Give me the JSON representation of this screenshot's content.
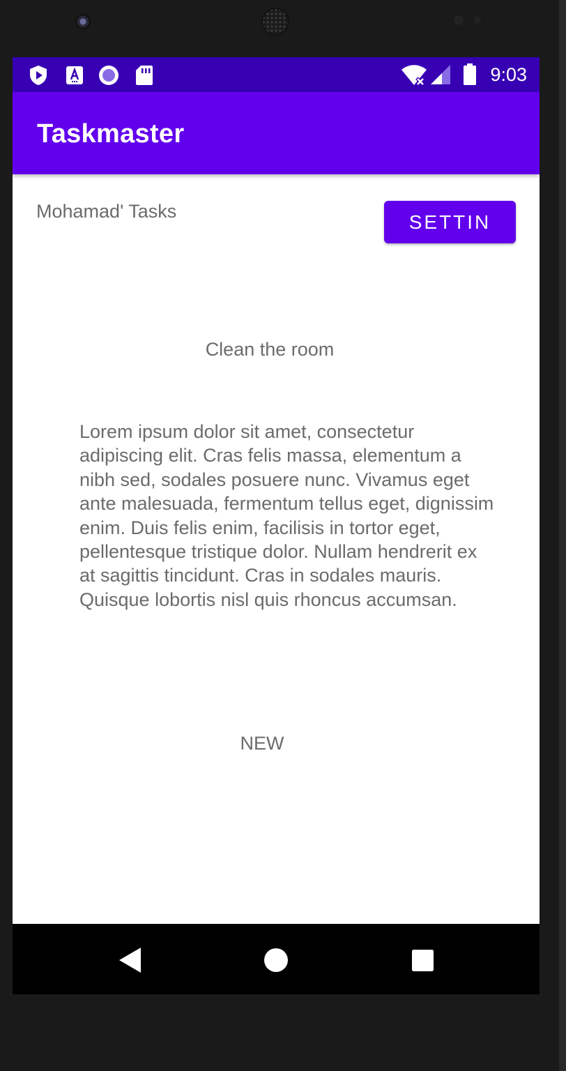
{
  "status_bar": {
    "time": "9:03",
    "left_icons": [
      "play-protect-icon",
      "accessibility-icon",
      "circle-app-icon",
      "sd-card-icon"
    ],
    "right_icons": [
      "wifi-off-icon",
      "signal-icon",
      "battery-icon"
    ]
  },
  "app_bar": {
    "title": "Taskmaster"
  },
  "main": {
    "user_tasks_label": "Mohamad' Tasks",
    "settings_button_label": "SETTIN",
    "task_title": "Clean the room",
    "task_body": "Lorem ipsum dolor sit amet, consectetur adipiscing elit. Cras felis massa, elementum a nibh sed, sodales posuere nunc. Vivamus eget ante malesuada, fermentum tellus eget, dignissim enim. Duis felis enim, facilisis in tortor eget, pellentesque tristique dolor. Nullam hendrerit ex at sagittis tincidunt. Cras in sodales mauris. Quisque lobortis nisl quis rhoncus accumsan.",
    "task_state": "NEW"
  },
  "nav_bar": {
    "buttons": [
      "back-icon",
      "home-icon",
      "recents-icon"
    ]
  },
  "colors": {
    "primary": "#6200ee",
    "primary_dark": "#3700b3",
    "text_secondary": "#6b6b6b"
  }
}
